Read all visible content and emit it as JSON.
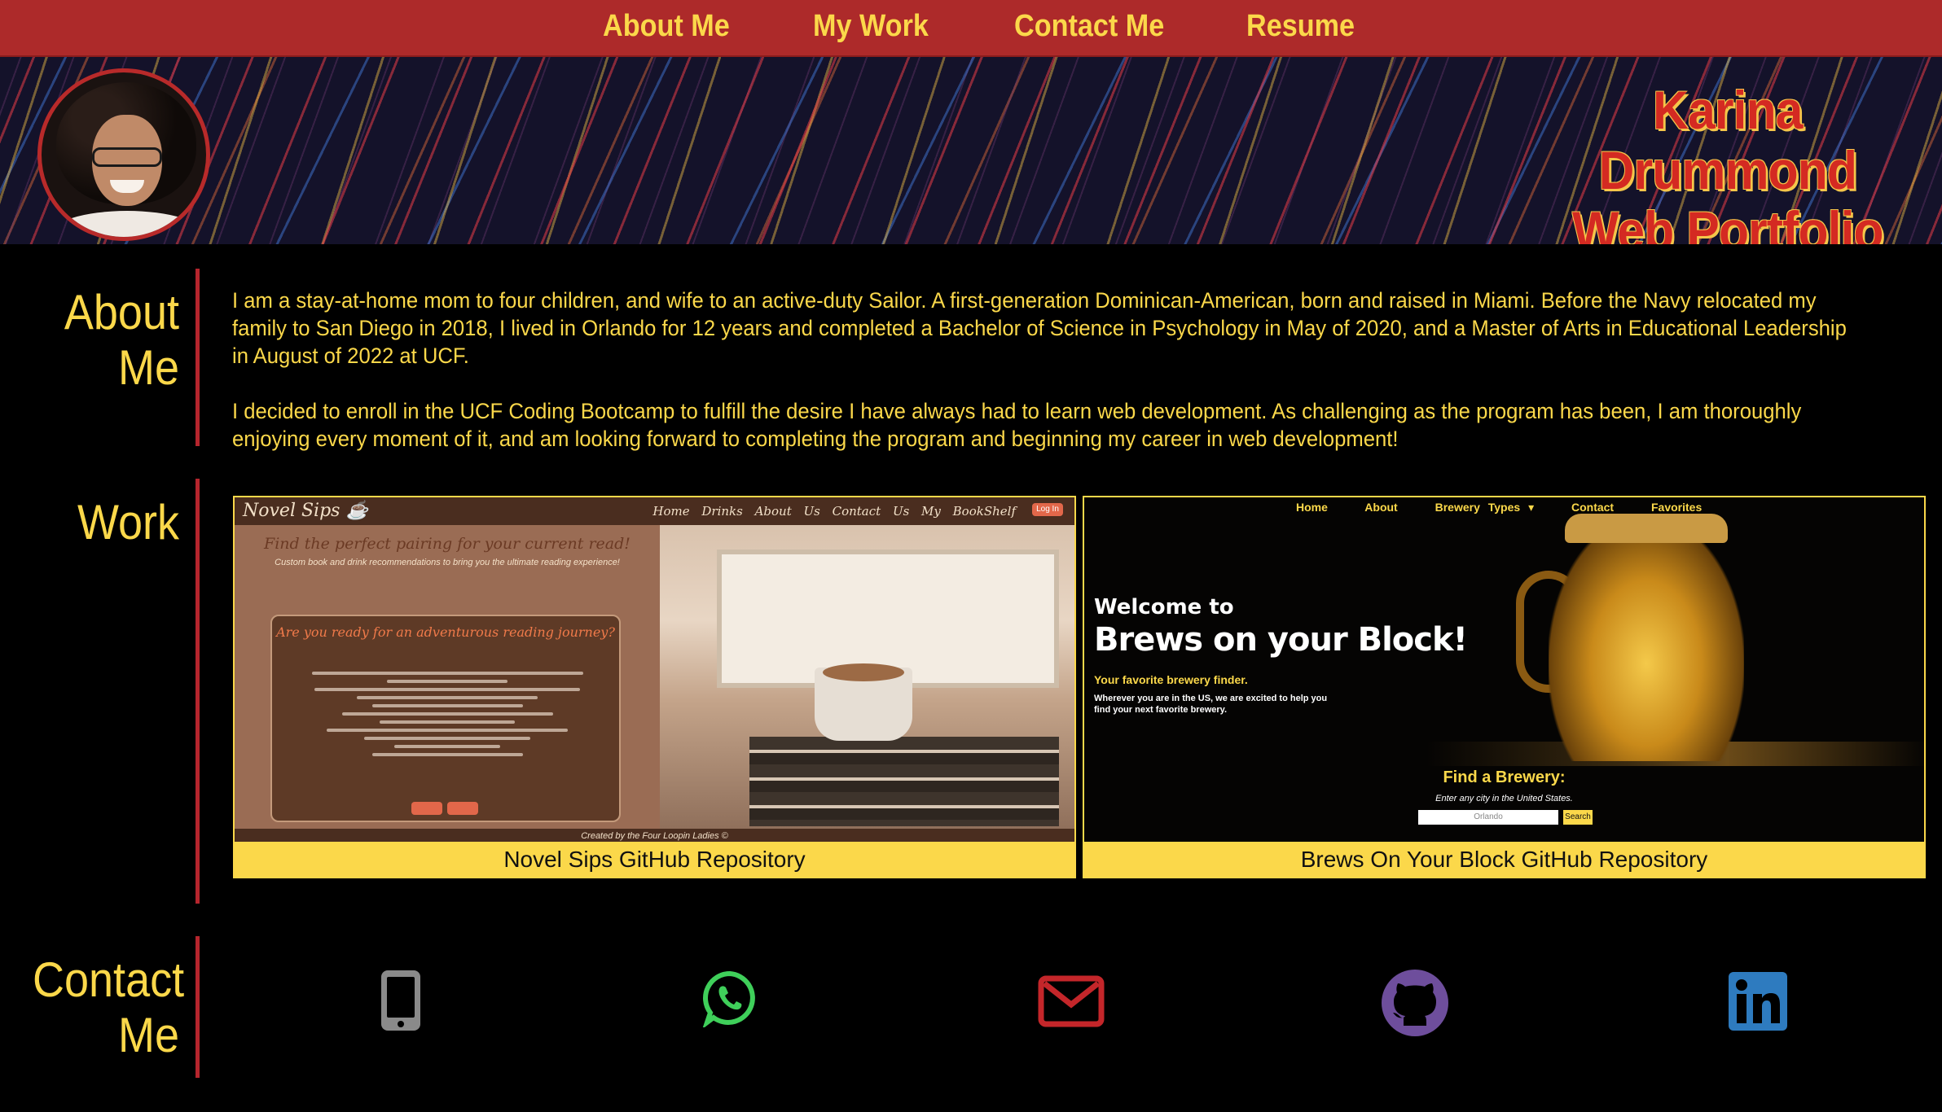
{
  "nav": {
    "links": [
      "About Me",
      "My Work",
      "Contact Me",
      "Resume"
    ]
  },
  "hero": {
    "title_line1": "Karina Drummond",
    "title_line2": "Web Portfolio",
    "avatar_alt": "Karina Drummond"
  },
  "about": {
    "heading_line1": "About",
    "heading_line2": "Me",
    "paragraphs": [
      "I am a stay-at-home mom to four children, and wife to an active-duty Sailor. A first-generation Dominican-American, born and raised in Miami. Before the Navy relocated my family to San Diego in 2018, I lived in Orlando for 12 years and completed a Bachelor of Science in Psychology in May of 2020, and a Master of Arts in Educational Leadership in August of 2022 at UCF.",
      "I decided to enroll in the UCF Coding Bootcamp to fulfill the desire I have always had to learn web development. As challenging as the program has been, I am thoroughly enjoying every moment of it, and am looking forward to completing the program and beginning my career in web development!"
    ]
  },
  "work": {
    "heading": "Work",
    "projects": [
      {
        "caption": "Novel Sips GitHub Repository",
        "screenshot": {
          "logo": "Novel Sips ☕",
          "nav": "Home Drinks About Us Contact Us My BookShelf",
          "login": "Log In",
          "tagline": "Find the perfect pairing for your current read!",
          "subtagline": "Custom book and drink recommendations to bring you the ultimate reading experience!",
          "question": "Are you ready for an adventurous reading journey?",
          "footer": "Created by the Four Loopin Ladies ©"
        }
      },
      {
        "caption": "Brews On Your Block GitHub Repository",
        "screenshot": {
          "nav": [
            "Home",
            "About",
            "Brewery Types ▾",
            "Contact",
            "Favorites"
          ],
          "welcome": "Welcome to",
          "title": "Brews on your Block!",
          "subtitle": "Your favorite brewery finder.",
          "blurb": "Wherever you are in the US, we are excited to help you find your next favorite brewery.",
          "find": "Find a Brewery:",
          "city_hint": "Enter any city in the United States.",
          "input_value": "Orlando",
          "search_label": "Search"
        }
      }
    ]
  },
  "contact": {
    "heading_line1": "Contact",
    "heading_line2": "Me",
    "icons": [
      "phone-icon",
      "whatsapp-icon",
      "email-icon",
      "github-icon",
      "linkedin-icon"
    ]
  },
  "colors": {
    "nav_bg": "#ad2a2a",
    "accent_yellow": "#fbd84a",
    "divider_red": "#b5252d",
    "page_bg": "#000000"
  }
}
